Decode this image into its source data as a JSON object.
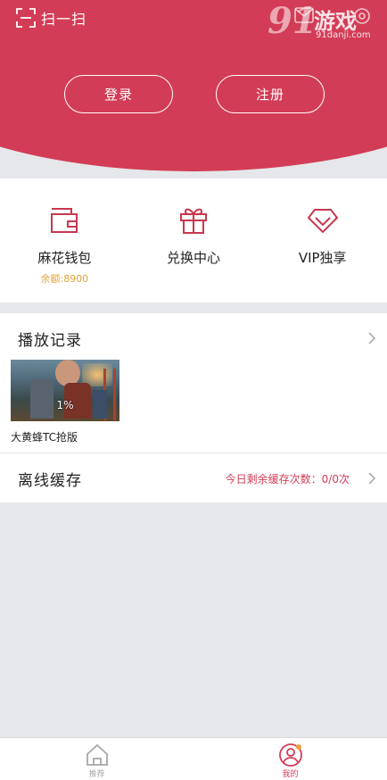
{
  "header": {
    "scan_label": "扫一扫",
    "login_label": "登录",
    "register_label": "注册",
    "watermark": {
      "logo": "91",
      "name": "游戏",
      "url": "91danji.com"
    },
    "accent": "#d33c56"
  },
  "features": [
    {
      "label": "麻花钱包",
      "sub": "余额:8900",
      "icon": "wallet-icon"
    },
    {
      "label": "兑换中心",
      "icon": "gift-icon"
    },
    {
      "label": "VIP独享",
      "icon": "diamond-icon"
    }
  ],
  "history": {
    "title": "播放记录",
    "items": [
      {
        "title": "大黄蜂TC抢版",
        "progress": "1%"
      }
    ]
  },
  "offline": {
    "title": "离线缓存",
    "quota": "今日剩余缓存次数：0/0次"
  },
  "tabbar": {
    "items": [
      {
        "label": "推荐",
        "icon": "home-icon"
      },
      {
        "label": "我的",
        "icon": "user-icon"
      }
    ]
  }
}
